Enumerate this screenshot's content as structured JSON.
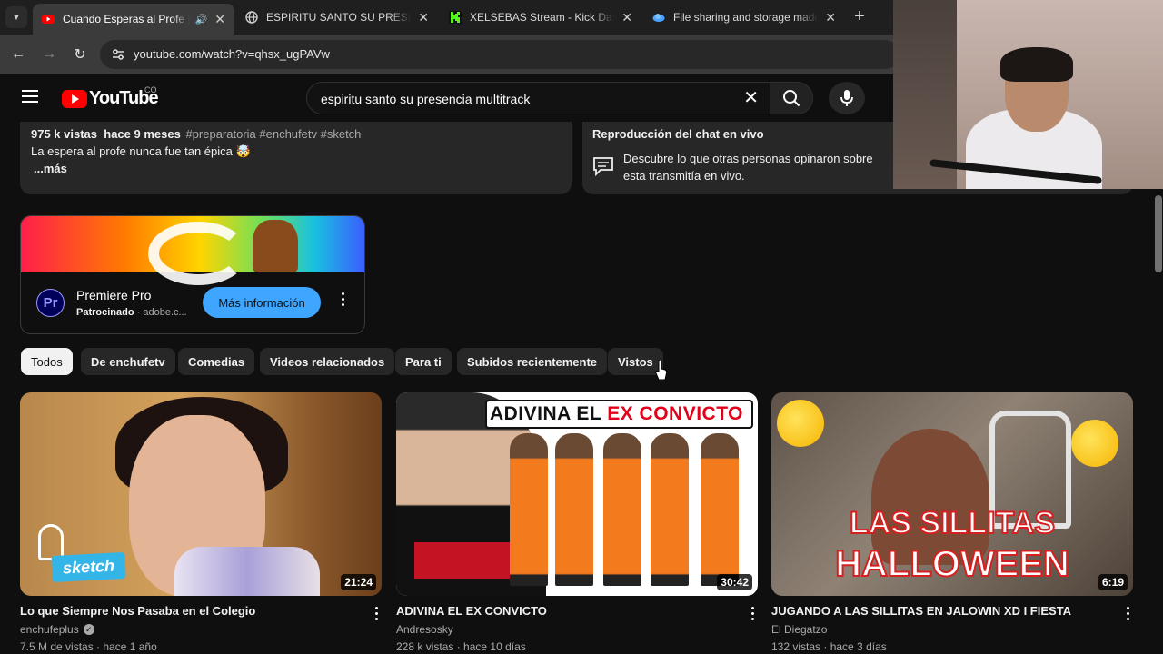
{
  "browser": {
    "tabs": [
      {
        "title": "Cuando Esperas al Profe | en",
        "active": true,
        "audio": true
      },
      {
        "title": "ESPIRITU SANTO SU PRESENCIA",
        "active": false
      },
      {
        "title": "XELSEBAS Stream - Kick Dashbo",
        "active": false
      },
      {
        "title": "File sharing and storage made s",
        "active": false
      }
    ],
    "url": "youtube.com/watch?v=qhsx_ugPAVw"
  },
  "youtube": {
    "logo_text": "YouTube",
    "country": "CO",
    "search_query": "espiritu santo su presencia multitrack"
  },
  "description": {
    "views": "975 k vistas",
    "age": "hace 9 meses",
    "tags": "#preparatoria #enchufetv #sketch",
    "text": "La espera al profe nunca fue tan épica 🤯",
    "more": "...más"
  },
  "chat": {
    "title": "Reproducción del chat en vivo",
    "text": "Descubre lo que otras personas opinaron sobre esta transmitía en vivo."
  },
  "ad": {
    "logo": "Pr",
    "title": "Premiere Pro",
    "sponsored": "Patrocinado",
    "domain": "adobe.c...",
    "cta": "Más información"
  },
  "chips": [
    {
      "label": "Todos",
      "selected": true
    },
    {
      "label": "De enchufetv"
    },
    {
      "label": "Comedias"
    },
    {
      "label": "Videos relacionados"
    },
    {
      "label": "Para ti"
    },
    {
      "label": "Subidos recientemente"
    },
    {
      "label": "Vistos"
    }
  ],
  "videos": [
    {
      "title": "Lo que Siempre Nos Pasaba en el Colegio",
      "channel": "enchufeplus",
      "verified": true,
      "views": "7.5 M de vistas",
      "age": "hace 1 año",
      "duration": "21:24",
      "badge": "sketch"
    },
    {
      "title": "ADIVINA EL EX CONVICTO",
      "channel": "Andresosky",
      "views": "228 k vistas",
      "age": "hace 10 días",
      "duration": "30:42",
      "thumb_text_a": "ADIVINA EL",
      "thumb_text_b": "EX CONVICTO"
    },
    {
      "title": "JUGANDO A LAS SILLITAS EN JALOWIN XD I FIESTA",
      "channel": "El Diegatzo",
      "views": "132 vistas",
      "age": "hace 3 días",
      "duration": "6:19",
      "thumb_text_a": "LAS SILLITAS",
      "thumb_text_b": "HALLOWEEN"
    }
  ],
  "colors": {
    "accent": "#3ea6ff",
    "brand": "#ff0000",
    "background": "#0f0f0f"
  }
}
